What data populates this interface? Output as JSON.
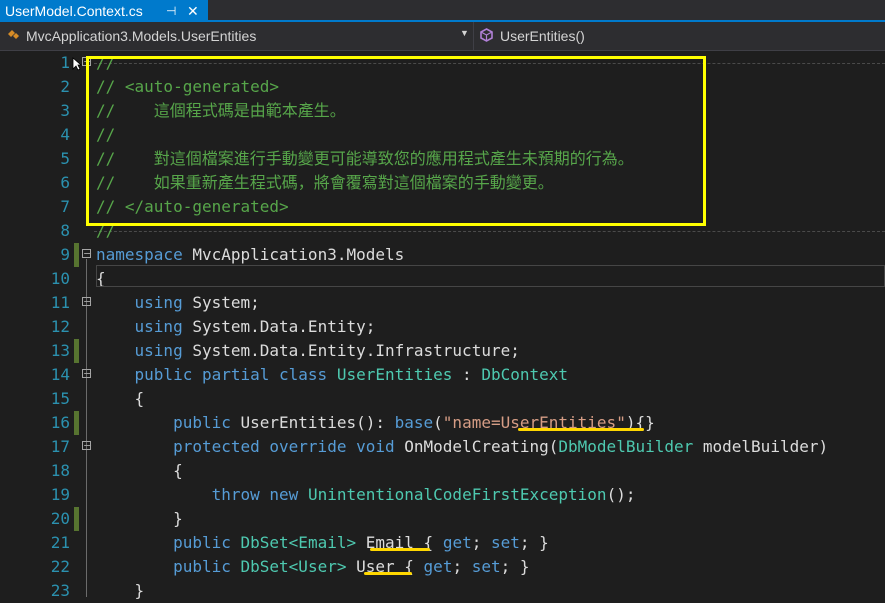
{
  "tab": {
    "title": "UserModel.Context.cs",
    "pin": "⊣",
    "close": "✕"
  },
  "navbar": {
    "left": "MvcApplication3.Models.UserEntities",
    "right": "UserEntities()"
  },
  "lines": [
    {
      "n": "1"
    },
    {
      "n": "2"
    },
    {
      "n": "3"
    },
    {
      "n": "4"
    },
    {
      "n": "5"
    },
    {
      "n": "6"
    },
    {
      "n": "7"
    },
    {
      "n": "8"
    },
    {
      "n": "9"
    },
    {
      "n": "10"
    },
    {
      "n": "11"
    },
    {
      "n": "12"
    },
    {
      "n": "13"
    },
    {
      "n": "14"
    },
    {
      "n": "15"
    },
    {
      "n": "16"
    },
    {
      "n": "17"
    },
    {
      "n": "18"
    },
    {
      "n": "19"
    },
    {
      "n": "20"
    },
    {
      "n": "21"
    },
    {
      "n": "22"
    },
    {
      "n": "23"
    }
  ],
  "code": {
    "l1": "//",
    "l2": "// <auto-generated>",
    "l3": "//    這個程式碼是由範本產生。",
    "l4": "//",
    "l5": "//    對這個檔案進行手動變更可能導致您的應用程式產生未預期的行為。",
    "l6": "//    如果重新產生程式碼，將會覆寫對這個檔案的手動變更。",
    "l7": "// </auto-generated>",
    "l8": "//",
    "l9_kw": "namespace",
    "l9_rest": " MvcApplication3.Models",
    "l10": "{",
    "l11_kw": "using",
    "l11_rest": " System;",
    "l12_kw": "using",
    "l12_rest": " System.Data.Entity;",
    "l13_kw": "using",
    "l13_rest": " System.Data.Entity.Infrastructure;",
    "l14_kw": "public partial class",
    "l14_ty1": "UserEntities",
    "l14_sep": " : ",
    "l14_ty2": "DbContext",
    "l15": "{",
    "l16_kw": "public",
    "l16_mid": " UserEntities(): ",
    "l16_kw2": "base",
    "l16_p1": "(",
    "l16_str": "\"name=UserEntities\"",
    "l16_end": "){}",
    "l17_kw": "protected override void",
    "l17_mid": " OnModelCreating(",
    "l17_ty": "DbModelBuilder",
    "l17_end": " modelBuilder)",
    "l18": "{",
    "l19_kw": "throw new",
    "l19_ty": "UnintentionalCodeFirstException",
    "l19_end": "();",
    "l20": "}",
    "l21_kw": "public",
    "l21_ty": "DbSet",
    "l21_g": "<Email>",
    "l21_name": "Email",
    "l21_b1": " { ",
    "l21_get": "get",
    "l21_s1": "; ",
    "l21_set": "set",
    "l21_end": "; }",
    "l22_kw": "public",
    "l22_ty": "DbSet",
    "l22_g": "<User>",
    "l22_name": "User",
    "l22_b1": " { ",
    "l22_get": "get",
    "l22_s1": "; ",
    "l22_set": "set",
    "l22_end": "; }",
    "l23": "}"
  }
}
